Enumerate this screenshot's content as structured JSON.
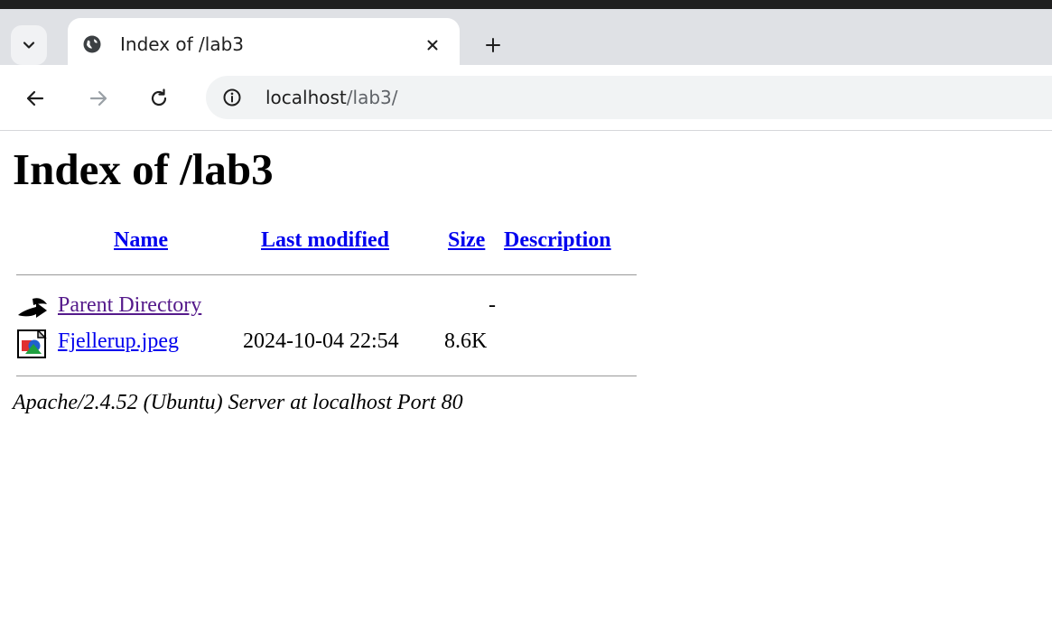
{
  "browser": {
    "tab": {
      "title": "Index of /lab3",
      "favicon": "globe-icon"
    },
    "url": {
      "host": "localhost",
      "path": "/lab3/"
    },
    "icons": {
      "tab_menu": "chevron-down-icon",
      "close": "close-icon",
      "new_tab": "plus-icon",
      "back": "back-arrow-icon",
      "forward": "forward-arrow-icon",
      "reload": "reload-icon",
      "site_info": "info-icon"
    }
  },
  "page": {
    "heading": "Index of /lab3",
    "columns": {
      "name": "Name",
      "last_modified": "Last modified",
      "size": "Size",
      "description": "Description"
    },
    "rows": [
      {
        "icon": "back-folder-icon",
        "name": "Parent Directory",
        "last_modified": "",
        "size": "-",
        "description": ""
      },
      {
        "icon": "image-file-icon",
        "name": "Fjellerup.jpeg",
        "last_modified": "2024-10-04 22:54",
        "size": "8.6K",
        "description": ""
      }
    ],
    "footer": "Apache/2.4.52 (Ubuntu) Server at localhost Port 80"
  },
  "colors": {
    "link": "#0000ee",
    "visited_link": "#551a8b",
    "tab_bar": "#dfe1e5",
    "omnibox": "#f1f3f4"
  }
}
